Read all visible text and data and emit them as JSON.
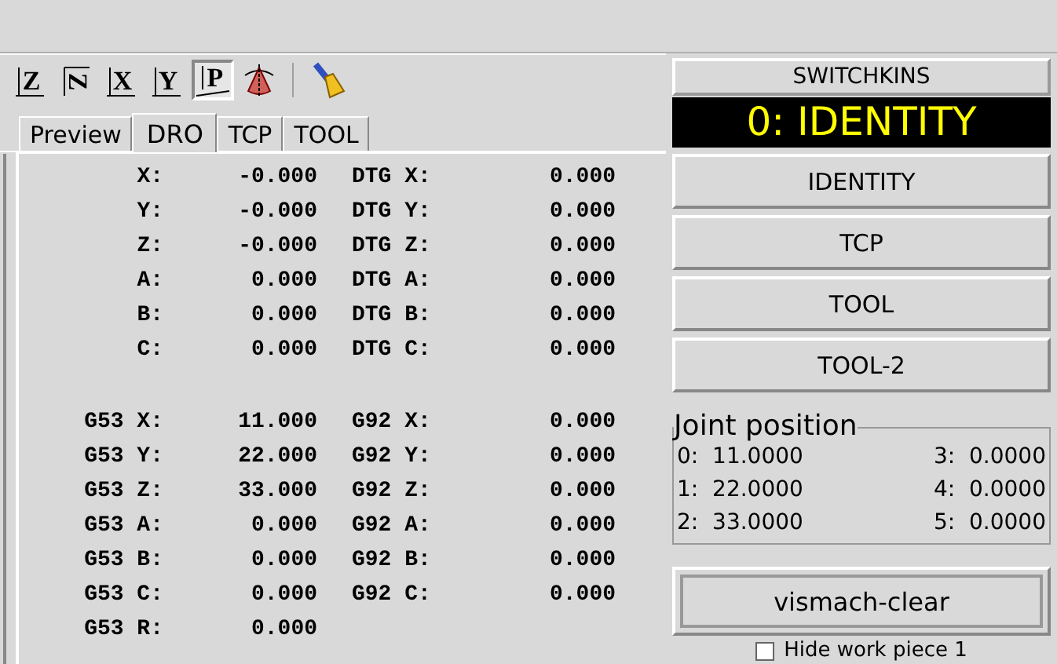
{
  "toolbar": [
    {
      "kind": "view",
      "label": "Z",
      "selected": false
    },
    {
      "kind": "view-rotated",
      "label": "Z",
      "selected": false
    },
    {
      "kind": "view",
      "label": "X",
      "selected": false
    },
    {
      "kind": "view",
      "label": "Y",
      "selected": false
    },
    {
      "kind": "view-p",
      "label": "P",
      "selected": true
    },
    {
      "kind": "cone",
      "selected": false
    },
    {
      "kind": "separator"
    },
    {
      "kind": "broom",
      "selected": false
    }
  ],
  "tabs": [
    {
      "label": "Preview",
      "selected": false
    },
    {
      "label": "DRO",
      "selected": true
    },
    {
      "label": "TCP",
      "selected": false
    },
    {
      "label": "TOOL",
      "selected": false
    }
  ],
  "dro": {
    "rows": [
      {
        "label": "X:",
        "value": "-0.000",
        "label_2": "DTG X:",
        "value_2": "0.000"
      },
      {
        "label": "Y:",
        "value": "-0.000",
        "label_2": "DTG Y:",
        "value_2": "0.000"
      },
      {
        "label": "Z:",
        "value": "-0.000",
        "label_2": "DTG Z:",
        "value_2": "0.000"
      },
      {
        "label": "A:",
        "value": "0.000",
        "label_2": "DTG A:",
        "value_2": "0.000"
      },
      {
        "label": "B:",
        "value": "0.000",
        "label_2": "DTG B:",
        "value_2": "0.000"
      },
      {
        "label": "C:",
        "value": "0.000",
        "label_2": "DTG C:",
        "value_2": "0.000"
      }
    ],
    "offset_rows": [
      {
        "label": "G53 X:",
        "value": "11.000",
        "label_2": "G92 X:",
        "value_2": "0.000"
      },
      {
        "label": "G53 Y:",
        "value": "22.000",
        "label_2": "G92 Y:",
        "value_2": "0.000"
      },
      {
        "label": "G53 Z:",
        "value": "33.000",
        "label_2": "G92 Z:",
        "value_2": "0.000"
      },
      {
        "label": "G53 A:",
        "value": "0.000",
        "label_2": "G92 A:",
        "value_2": "0.000"
      },
      {
        "label": "G53 B:",
        "value": "0.000",
        "label_2": "G92 B:",
        "value_2": "0.000"
      },
      {
        "label": "G53 C:",
        "value": "0.000",
        "label_2": "G92 C:",
        "value_2": "0.000"
      },
      {
        "label": "G53 R:",
        "value": "0.000"
      }
    ]
  },
  "switchkins": {
    "title": "SWITCHKINS",
    "display": "0: IDENTITY",
    "buttons": [
      "IDENTITY",
      "TCP",
      "TOOL",
      "TOOL-2"
    ]
  },
  "joint_position": {
    "title": "Joint position",
    "joints": [
      {
        "index": "0:",
        "value": "11.0000"
      },
      {
        "index": "3:",
        "value": "0.0000"
      },
      {
        "index": "1:",
        "value": "22.0000"
      },
      {
        "index": "4:",
        "value": "0.0000"
      },
      {
        "index": "2:",
        "value": "33.0000"
      },
      {
        "index": "5:",
        "value": "0.0000"
      }
    ]
  },
  "vismach_button": "vismach-clear",
  "hide_work_piece": {
    "label": "Hide work piece 1",
    "checked": false
  }
}
